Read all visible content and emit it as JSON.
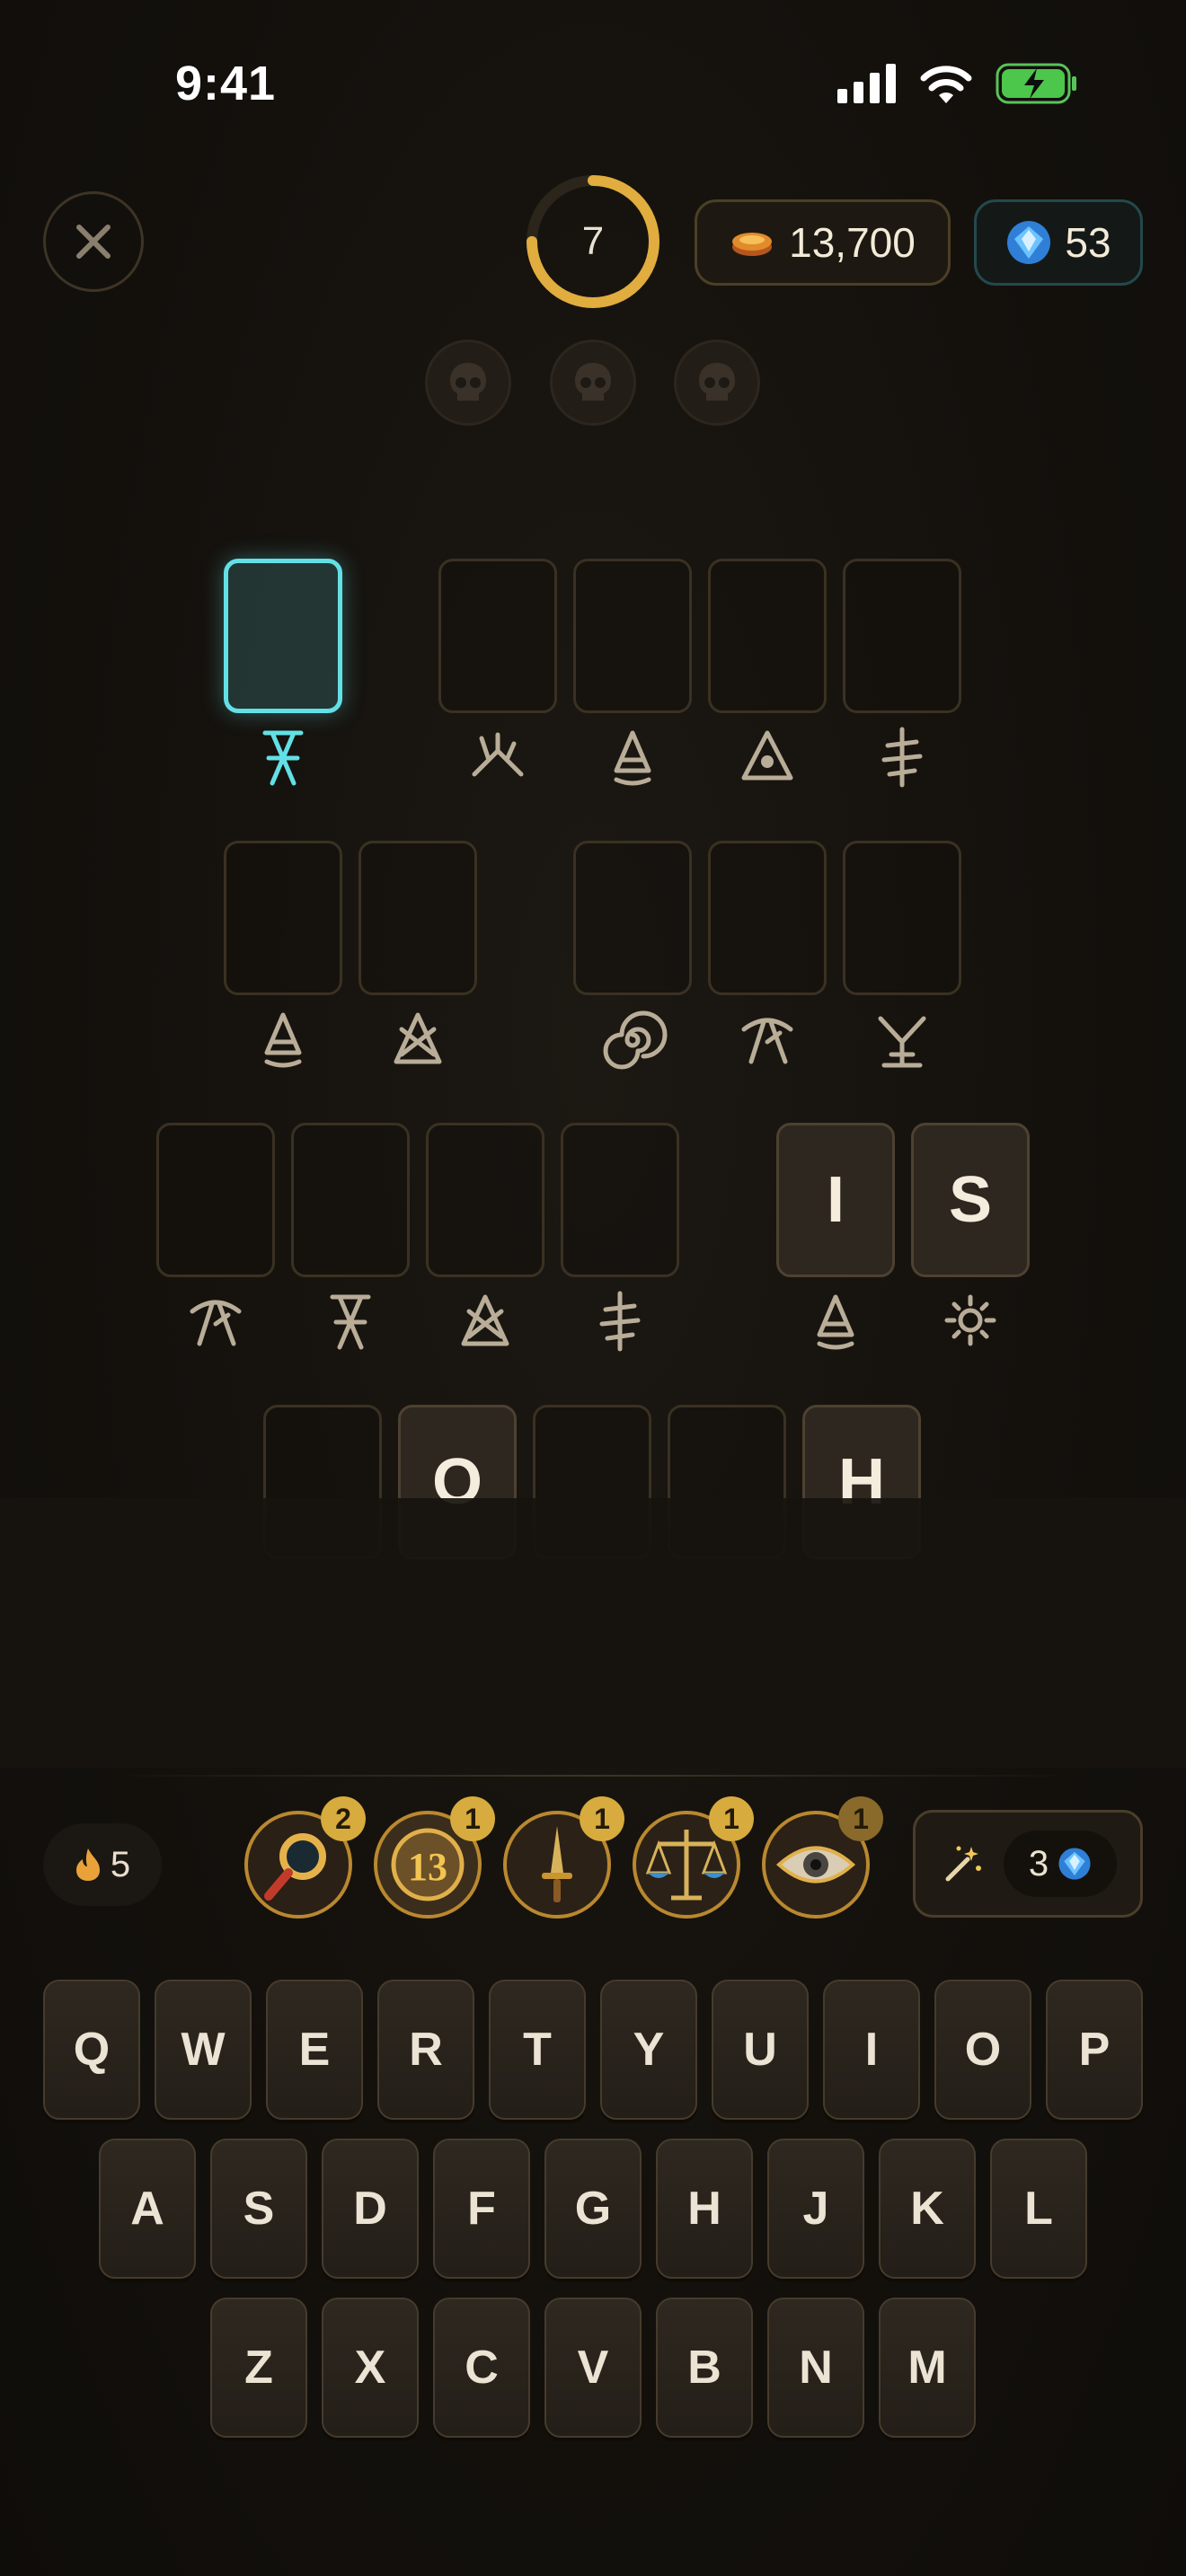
{
  "status_bar": {
    "time": "9:41"
  },
  "header": {
    "close_label": "✕",
    "timer_value": "7",
    "timer_progress": 0.75,
    "coins": "13,700",
    "gems": "53"
  },
  "penalties": {
    "count": 3
  },
  "puzzle": {
    "rows": [
      {
        "words": [
          [
            {
              "letter": "",
              "glyph": "rune-a",
              "active": true
            }
          ],
          [
            {
              "letter": "",
              "glyph": "rune-b"
            },
            {
              "letter": "",
              "glyph": "rune-c"
            },
            {
              "letter": "",
              "glyph": "rune-d"
            },
            {
              "letter": "",
              "glyph": "rune-e"
            }
          ]
        ]
      },
      {
        "words": [
          [
            {
              "letter": "",
              "glyph": "rune-c"
            },
            {
              "letter": "",
              "glyph": "rune-f"
            }
          ],
          [
            {
              "letter": "",
              "glyph": "rune-g"
            },
            {
              "letter": "",
              "glyph": "rune-h"
            },
            {
              "letter": "",
              "glyph": "rune-i"
            }
          ]
        ]
      },
      {
        "words": [
          [
            {
              "letter": "",
              "glyph": "rune-h"
            },
            {
              "letter": "",
              "glyph": "rune-a"
            },
            {
              "letter": "",
              "glyph": "rune-f"
            },
            {
              "letter": "",
              "glyph": "rune-e"
            }
          ],
          [
            {
              "letter": "I",
              "glyph": "rune-c"
            },
            {
              "letter": "S",
              "glyph": "rune-j"
            }
          ]
        ]
      },
      {
        "words": [
          [
            {
              "letter": "",
              "glyph": ""
            },
            {
              "letter": "O",
              "glyph": ""
            },
            {
              "letter": "",
              "glyph": ""
            },
            {
              "letter": "",
              "glyph": ""
            },
            {
              "letter": "H",
              "glyph": ""
            }
          ]
        ]
      }
    ]
  },
  "powerups": {
    "streak": "5",
    "items": [
      {
        "name": "magnifier",
        "count": "2"
      },
      {
        "name": "lucky-coin",
        "count": "1"
      },
      {
        "name": "dagger",
        "count": "1"
      },
      {
        "name": "scales",
        "count": "1"
      },
      {
        "name": "eye",
        "count": "1"
      }
    ],
    "hint_cost": "3"
  },
  "keyboard": {
    "rows": [
      [
        "Q",
        "W",
        "E",
        "R",
        "T",
        "Y",
        "U",
        "I",
        "O",
        "P"
      ],
      [
        "A",
        "S",
        "D",
        "F",
        "G",
        "H",
        "J",
        "K",
        "L"
      ],
      [
        "Z",
        "X",
        "C",
        "V",
        "B",
        "N",
        "M"
      ]
    ]
  },
  "colors": {
    "accent_cyan": "#62e0e6",
    "gold": "#d7ab3d",
    "background": "#14110d"
  }
}
